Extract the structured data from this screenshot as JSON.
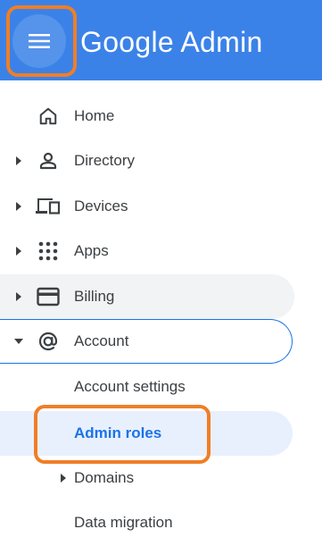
{
  "header": {
    "app_title": "Google Admin",
    "menu_icon": "hamburger-menu-icon",
    "background_color": "#3b82e8",
    "highlight_color": "#f07e26"
  },
  "nav": {
    "items": [
      {
        "label": "Home",
        "icon": "home-icon"
      },
      {
        "label": "Directory",
        "icon": "person-icon"
      },
      {
        "label": "Devices",
        "icon": "devices-icon"
      },
      {
        "label": "Apps",
        "icon": "apps-grid-icon"
      },
      {
        "label": "Billing",
        "icon": "credit-card-icon"
      },
      {
        "label": "Account",
        "icon": "at-sign-icon",
        "expanded": true
      }
    ],
    "account_subitems": [
      {
        "label": "Account settings"
      },
      {
        "label": "Admin roles",
        "selected": true
      },
      {
        "label": "Domains"
      },
      {
        "label": "Data migration"
      }
    ],
    "active_color": "#1a73e8"
  }
}
